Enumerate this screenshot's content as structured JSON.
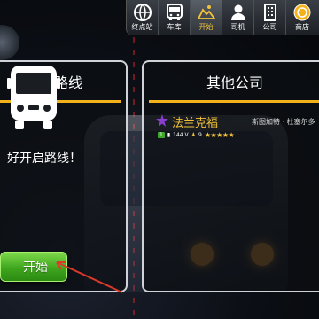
{
  "nav": {
    "items": [
      {
        "label": "终点站",
        "icon": "globe-icon",
        "active": false
      },
      {
        "label": "车库",
        "icon": "bus-front-icon",
        "active": false
      },
      {
        "label": "开始",
        "icon": "map-icon",
        "active": true
      },
      {
        "label": "司机",
        "icon": "person-icon",
        "active": false
      },
      {
        "label": "公司",
        "icon": "building-icon",
        "active": false
      },
      {
        "label": "商店",
        "icon": "coins-icon",
        "active": false
      }
    ]
  },
  "route_panel": {
    "title": "路线",
    "prompt": "好开启路线！",
    "start_button": "开始"
  },
  "company_panel": {
    "title": "其他公司",
    "company": {
      "name": "法兰克福",
      "location": "斯图加特 · 杜塞尔多",
      "level": "1",
      "vehicles": "144 V",
      "drivers": "9",
      "rating": "★★★★★"
    }
  },
  "colors": {
    "accent": "#f3b21c",
    "active_label": "#f3c33a",
    "start_button": "#3fa61e"
  }
}
